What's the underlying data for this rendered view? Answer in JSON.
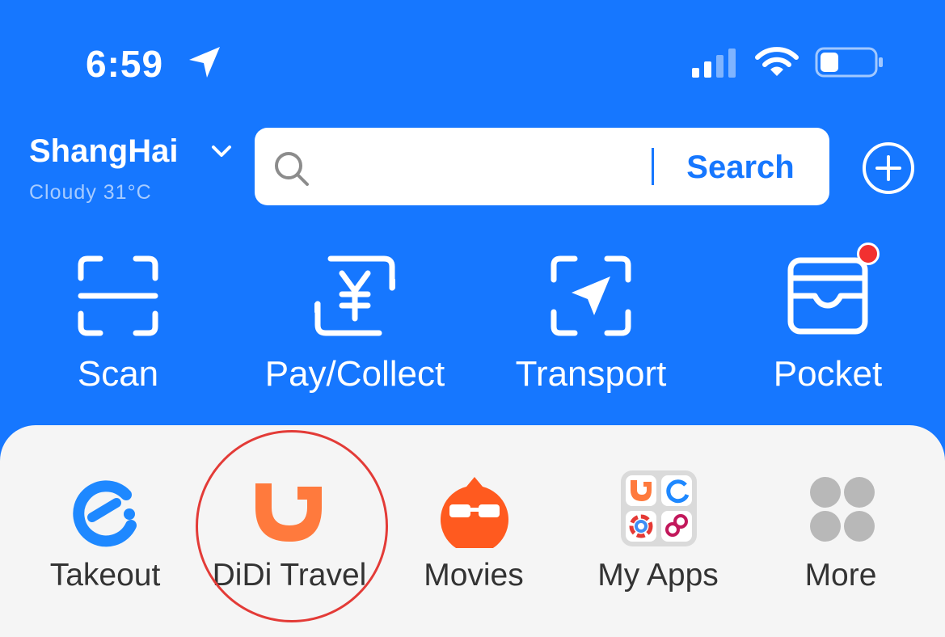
{
  "status_bar": {
    "time": "6:59"
  },
  "header": {
    "city": "ShangHai",
    "weather": "Cloudy 31°C",
    "search": {
      "placeholder": "",
      "button_label": "Search"
    }
  },
  "quick_actions": [
    {
      "label": "Scan",
      "icon": "scan-icon"
    },
    {
      "label": "Pay/Collect",
      "icon": "yuan-exchange-icon"
    },
    {
      "label": "Transport",
      "icon": "transport-arrow-icon"
    },
    {
      "label": "Pocket",
      "icon": "wallet-icon",
      "badge": true
    }
  ],
  "apps": [
    {
      "label": "Takeout",
      "icon": "takeout-e-icon"
    },
    {
      "label": "DiDi Travel",
      "icon": "didi-icon",
      "highlighted": true
    },
    {
      "label": "Movies",
      "icon": "movies-glasses-icon"
    },
    {
      "label": "My Apps",
      "icon": "my-apps-grid-icon"
    },
    {
      "label": "More",
      "icon": "more-dots-icon"
    }
  ],
  "colors": {
    "primary": "#1677FF",
    "panel": "#F5F5F5",
    "badge": "#F23030",
    "annotation": "#E33B37",
    "takeout": "#1E88FF",
    "didi": "#FF7A3D",
    "movies": "#FF5A1F"
  }
}
